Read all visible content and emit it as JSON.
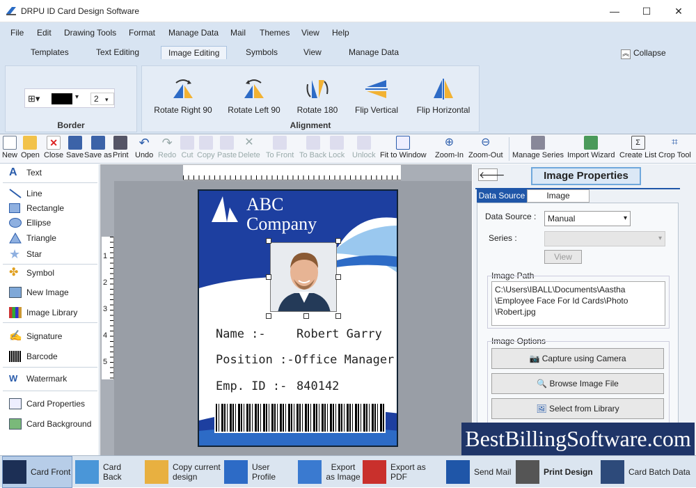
{
  "window": {
    "title": "DRPU ID Card Design Software",
    "min": "—",
    "max": "☐",
    "close": "✕"
  },
  "menu": [
    "File",
    "Edit",
    "Drawing Tools",
    "Format",
    "Manage Data",
    "Mail",
    "Themes",
    "View",
    "Help"
  ],
  "tabs": [
    "Templates",
    "Text Editing",
    "Image Editing",
    "Symbols",
    "View",
    "Manage Data"
  ],
  "active_tab": "Image Editing",
  "collapse": "Collapse",
  "ribbon": {
    "border_group": "Border",
    "border_width": "2",
    "alignment_group": "Alignment",
    "buttons": [
      "Rotate Right 90",
      "Rotate Left 90",
      "Rotate 180",
      "Flip Vertical",
      "Flip Horizontal"
    ]
  },
  "toolbar": [
    "New",
    "Open",
    "Close",
    "Save",
    "Save as",
    "Print",
    "Undo",
    "Redo",
    "Cut",
    "Copy",
    "Paste",
    "Delete",
    "To Front",
    "To Back",
    "Lock",
    "Unlock",
    "Fit to Window",
    "Zoom-In",
    "Zoom-Out",
    "Manage Series",
    "Import Wizard",
    "Create List",
    "Crop Tool"
  ],
  "toolbar_disabled": [
    "Redo",
    "Cut",
    "Copy",
    "Paste",
    "Delete",
    "To Front",
    "To Back",
    "Lock",
    "Unlock"
  ],
  "left": {
    "text": "Text",
    "line": "Line",
    "rectangle": "Rectangle",
    "ellipse": "Ellipse",
    "triangle": "Triangle",
    "star": "Star",
    "symbol": "Symbol",
    "new_image": "New Image",
    "image_library": "Image Library",
    "signature": "Signature",
    "barcode": "Barcode",
    "watermark": "Watermark",
    "card_properties": "Card Properties",
    "card_background": "Card Background"
  },
  "ruler_left": [
    "1",
    "2",
    "3",
    "4",
    "5"
  ],
  "card": {
    "company_line1": "ABC",
    "company_line2": "Company",
    "name_label": "Name :-",
    "name_value": "Robert Garry",
    "position_label": "Position :-",
    "position_value": "Office Manager",
    "emp_label": "Emp. ID :-",
    "emp_value": "840142"
  },
  "props": {
    "header": "Image Properties",
    "tab_data_source": "Data Source",
    "tab_image_properties": "Image Properties",
    "data_source_label": "Data Source :",
    "data_source_value": "Manual",
    "series_label": "Series :",
    "view_button": "View",
    "image_path_label": "Image Path",
    "image_path": "C:\\Users\\IBALL\\Documents\\Aastha\n\\Employee Face For Id Cards\\Photo\n\\Robert.jpg",
    "image_options_label": "Image Options",
    "capture": "Capture using Camera",
    "browse": "Browse Image File",
    "library": "Select from Library"
  },
  "watermark_text": "BestBillingSoftware.com",
  "bottom": {
    "card_front": "Card Front",
    "card_back": "Card Back",
    "copy_design": "Copy current design",
    "user_profile": "User Profile",
    "export_image": "Export as Image",
    "export_pdf": "Export as PDF",
    "send_mail": "Send Mail",
    "print_design": "Print Design",
    "batch_data": "Card Batch Data"
  },
  "colors": {
    "accent": "#1f56a8",
    "card_blue": "#1d3fa0",
    "ribbon": "#d8e4f2"
  }
}
